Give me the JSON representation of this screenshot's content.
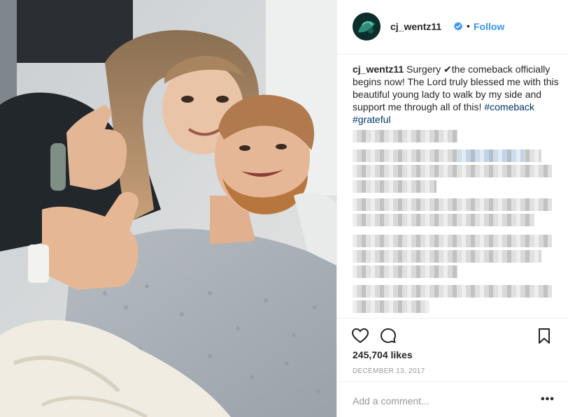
{
  "post": {
    "image_alt": "Hospital selfie photo",
    "author": {
      "username": "cj_wentz11",
      "verified": true,
      "separator": "•",
      "follow_label": "Follow"
    },
    "caption": {
      "username": "cj_wentz11",
      "text_part1": " Surgery ",
      "check_mark": "✔",
      "text_part2": "the comeback officially begins now! The Lord truly blessed me with this beautiful young lady to walk by my side and support me through all of this! ",
      "hashtag1": "#comeback",
      "space": " ",
      "hashtag2": "#grateful"
    },
    "likes_label": "245,704 likes",
    "date": "DECEMBER 13, 2017",
    "comment_placeholder": "Add a comment...",
    "more_label": "•••"
  },
  "icons": {
    "like": "heart-icon",
    "comment": "comment-icon",
    "save": "bookmark-icon",
    "verified": "verified-badge-icon",
    "more": "more-options-icon"
  },
  "colors": {
    "link_blue": "#3897f0",
    "hashtag": "#003569",
    "verified": "#3897f0",
    "muted": "#999999",
    "text": "#262626"
  }
}
